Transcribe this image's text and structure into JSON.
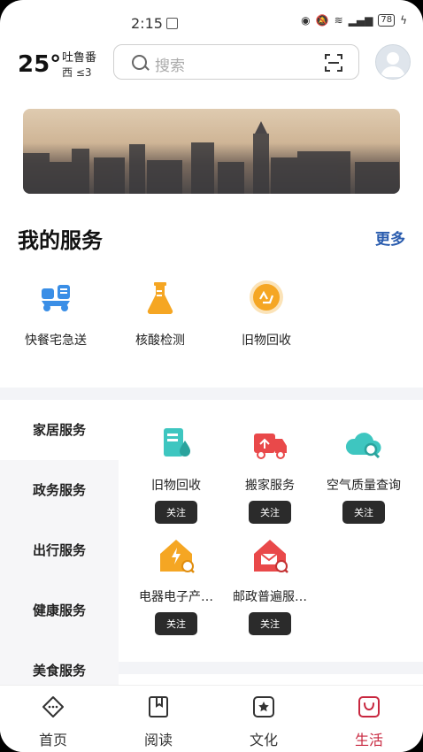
{
  "status": {
    "time": "2:15",
    "battery": "78"
  },
  "weather": {
    "temperature": "25°",
    "city": "吐鲁番",
    "wind": "西 ≤3"
  },
  "search": {
    "placeholder": "搜索"
  },
  "my_services": {
    "title": "我的服务",
    "more": "更多",
    "items": [
      {
        "label": "快餐宅急送",
        "icon": "delivery-scooter-icon"
      },
      {
        "label": "核酸检测",
        "icon": "test-flask-icon"
      },
      {
        "label": "旧物回收",
        "icon": "recycle-icon"
      }
    ]
  },
  "categories": [
    "家居服务",
    "政务服务",
    "出行服务",
    "健康服务",
    "美食服务"
  ],
  "category_services": [
    {
      "label": "旧物回收",
      "follow": "关注",
      "icon": "document-drop-icon"
    },
    {
      "label": "搬家服务",
      "follow": "关注",
      "icon": "moving-truck-icon"
    },
    {
      "label": "空气质量查询",
      "follow": "关注",
      "icon": "cloud-search-icon"
    },
    {
      "label": "电器电子产…",
      "follow": "关注",
      "icon": "house-power-icon"
    },
    {
      "label": "邮政普遍服…",
      "follow": "关注",
      "icon": "house-mail-icon"
    }
  ],
  "tabs": [
    {
      "label": "首页",
      "icon": "home-icon"
    },
    {
      "label": "阅读",
      "icon": "book-icon"
    },
    {
      "label": "文化",
      "icon": "star-box-icon"
    },
    {
      "label": "生活",
      "icon": "life-bag-icon"
    }
  ],
  "colors": {
    "accent": "#c8273f",
    "link": "#2a5cae",
    "teal": "#3ec6c0",
    "red": "#e9494a",
    "orange": "#f5a623"
  }
}
